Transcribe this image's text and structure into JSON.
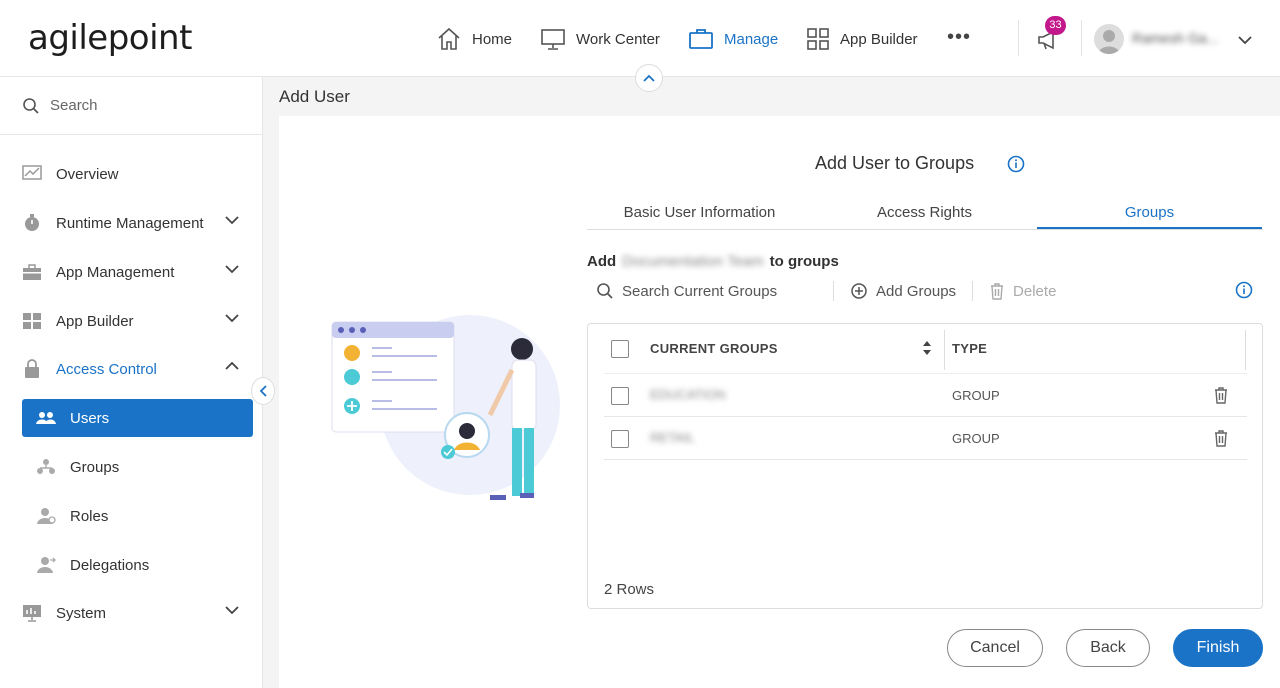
{
  "header": {
    "logo": "agilepoint",
    "nav": [
      {
        "label": "Home",
        "icon": "home-icon"
      },
      {
        "label": "Work Center",
        "icon": "monitor-icon"
      },
      {
        "label": "Manage",
        "icon": "briefcase-icon",
        "active": true
      },
      {
        "label": "App Builder",
        "icon": "grid-icon"
      }
    ],
    "more": "•••",
    "notifications_count": "33",
    "user_name": "Ramesh Ga..."
  },
  "sidebar": {
    "search_placeholder": "Search",
    "items": [
      {
        "label": "Overview"
      },
      {
        "label": "Runtime Management"
      },
      {
        "label": "App Management"
      },
      {
        "label": "App Builder"
      },
      {
        "label": "Access Control"
      },
      {
        "label": "Users"
      },
      {
        "label": "Groups"
      },
      {
        "label": "Roles"
      },
      {
        "label": "Delegations"
      },
      {
        "label": "System"
      }
    ]
  },
  "page": {
    "title": "Add User",
    "form_title": "Add User to Groups",
    "tabs": [
      {
        "label": "Basic User Information"
      },
      {
        "label": "Access Rights"
      },
      {
        "label": "Groups",
        "active": true
      }
    ],
    "add_prefix": "Add",
    "add_target": "Documentation Team",
    "add_suffix": "to groups"
  },
  "toolbar": {
    "search_placeholder": "Search Current Groups",
    "add_groups": "Add Groups",
    "delete": "Delete"
  },
  "grid": {
    "columns": [
      "CURRENT GROUPS",
      "TYPE"
    ],
    "rows": [
      {
        "name": "EDUCATION",
        "type": "GROUP"
      },
      {
        "name": "RETAIL",
        "type": "GROUP"
      }
    ],
    "row_count": "2 Rows"
  },
  "buttons": {
    "cancel": "Cancel",
    "back": "Back",
    "finish": "Finish"
  },
  "colors": {
    "accent": "#1a73c6",
    "badge": "#c2188b"
  }
}
